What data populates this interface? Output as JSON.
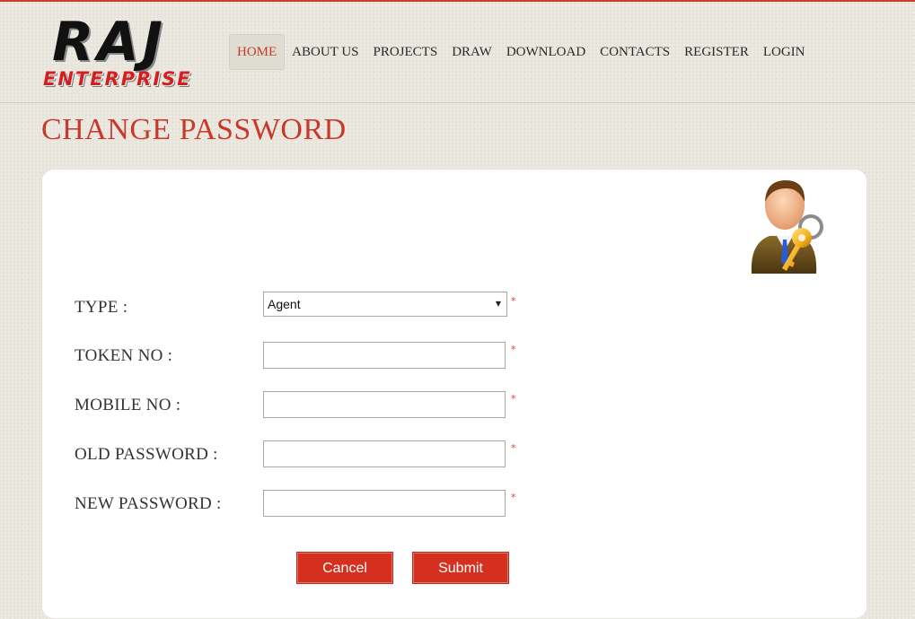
{
  "brand": {
    "name": "RAJ",
    "tagline": "ENTERPRISE"
  },
  "nav": {
    "items": [
      {
        "label": "HOME",
        "active": true
      },
      {
        "label": "ABOUT US"
      },
      {
        "label": "PROJECTS"
      },
      {
        "label": "DRAW"
      },
      {
        "label": "DOWNLOAD"
      },
      {
        "label": "CONTACTS"
      },
      {
        "label": "REGISTER"
      },
      {
        "label": "LOGIN"
      }
    ]
  },
  "page": {
    "title": "CHANGE PASSWORD"
  },
  "form": {
    "type": {
      "label": "TYPE :",
      "value": "Agent",
      "required_mark": "*"
    },
    "token_no": {
      "label": "TOKEN NO :",
      "value": "",
      "required_mark": "*"
    },
    "mobile_no": {
      "label": "MOBILE NO :",
      "value": "",
      "required_mark": "*"
    },
    "old_password": {
      "label": "OLD PASSWORD :",
      "value": "",
      "required_mark": "*"
    },
    "new_password": {
      "label": "NEW PASSWORD :",
      "value": "",
      "required_mark": "*"
    },
    "cancel_label": "Cancel",
    "submit_label": "Submit"
  },
  "icons": {
    "avatar": "user-key-icon",
    "select_arrow": "chevron-down-icon"
  },
  "colors": {
    "accent": "#c7392a",
    "button": "#d5301f",
    "required": "#e53b3b"
  }
}
